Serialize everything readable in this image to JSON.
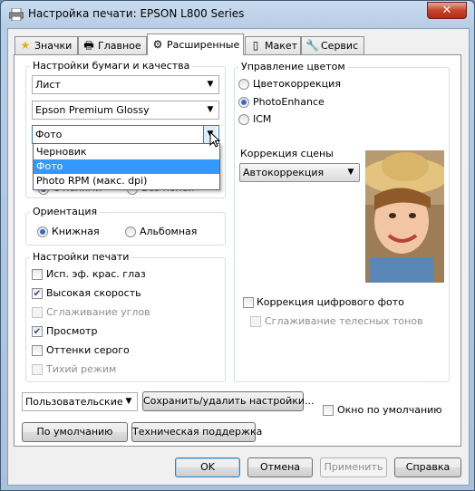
{
  "window": {
    "title": "Настройка печати: EPSON L800 Series",
    "close": "✕"
  },
  "tabs": [
    {
      "label": "Значки",
      "icon": "star-icon"
    },
    {
      "label": "Главное",
      "icon": "printer-icon"
    },
    {
      "label": "Расширенные",
      "icon": "gear-icon",
      "active": true
    },
    {
      "label": "Макет",
      "icon": "page-icon"
    },
    {
      "label": "Сервис",
      "icon": "wrench-icon"
    }
  ],
  "paper": {
    "group_label": "Настройки бумаги и качества",
    "source": "Лист",
    "type": "Epson Premium Glossy",
    "quality": "Фото",
    "quality_options": [
      "Черновик",
      "Фото",
      "Photo RPM (макс. dpi)"
    ],
    "quality_selected": "Фото",
    "hidden_partial_left": "С полями",
    "hidden_partial_right": "Без полей"
  },
  "orientation": {
    "group_label": "Ориентация",
    "portrait": "Книжная",
    "landscape": "Альбомная",
    "selected": "Книжная"
  },
  "print_settings": {
    "group_label": "Настройки печати",
    "items": [
      {
        "label": "Исп. эф. крас. глаз",
        "checked": false,
        "enabled": true
      },
      {
        "label": "Высокая скорость",
        "checked": true,
        "enabled": true
      },
      {
        "label": "Сглаживание углов",
        "checked": false,
        "enabled": false
      },
      {
        "label": "Просмотр",
        "checked": true,
        "enabled": true
      },
      {
        "label": "Оттенки серого",
        "checked": false,
        "enabled": true
      },
      {
        "label": "Тихий режим",
        "checked": false,
        "enabled": false
      }
    ]
  },
  "color": {
    "group_label": "Управление цветом",
    "options": [
      "Цветокоррекция",
      "PhotoEnhance",
      "ICM"
    ],
    "selected": "PhotoEnhance",
    "scene_label": "Коррекция сцены",
    "scene_value": "Автокоррекция",
    "digital_fix": "Коррекция цифрового фото",
    "skin_smooth": "Сглаживание телесных тонов"
  },
  "bottom": {
    "preset": "Пользовательские",
    "save_delete": "Сохранить/удалить настройки...",
    "default_window": "Окно по умолчанию",
    "defaults": "По умолчанию",
    "support": "Техническая поддержка"
  },
  "dialog": {
    "ok": "OK",
    "cancel": "Отмена",
    "apply": "Применить",
    "help": "Справка"
  },
  "colors": {
    "selection": "#3399ff",
    "title_gradient_top": "#c9dcef",
    "close_red": "#c7442b"
  }
}
